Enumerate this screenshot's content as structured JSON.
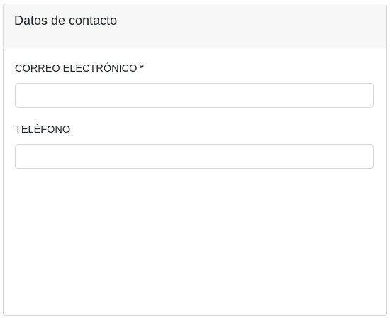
{
  "card": {
    "title": "Datos de contacto",
    "fields": [
      {
        "label": "CORREO ELECTRÓNICO *",
        "value": "",
        "placeholder": ""
      },
      {
        "label": "TELÉFONO",
        "value": "",
        "placeholder": ""
      }
    ]
  }
}
